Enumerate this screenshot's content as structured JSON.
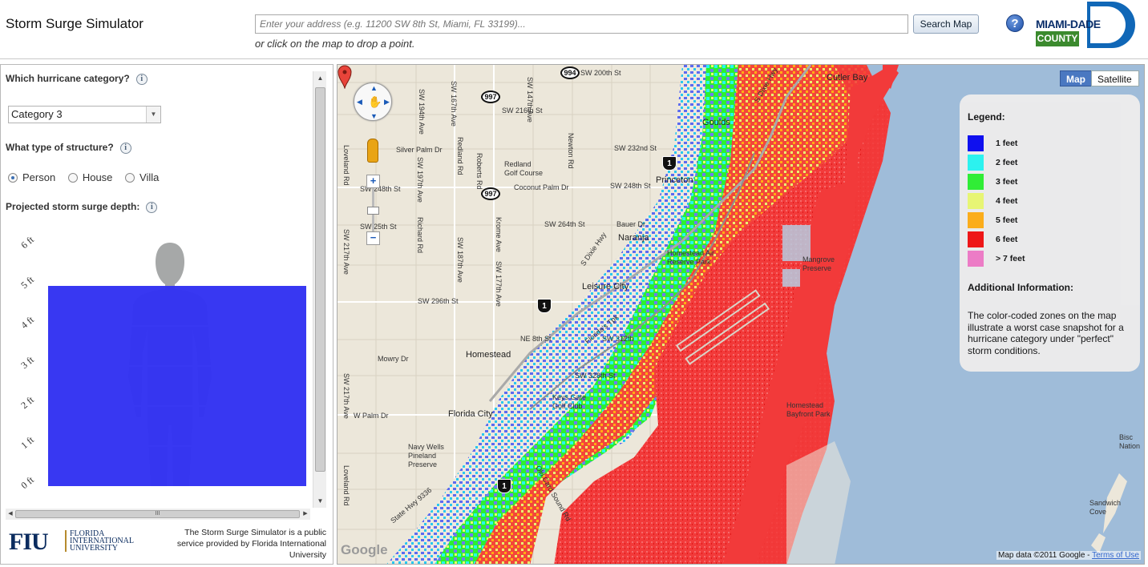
{
  "header": {
    "title": "Storm Surge Simulator",
    "search_placeholder": "Enter your address (e.g. 11200 SW 8th St, Miami, FL 33199)...",
    "search_button": "Search Map",
    "hint": "or click on the map to drop a point.",
    "help_icon": "?",
    "logo_line1": "MIAMI-DADE",
    "logo_line2": "COUNTY"
  },
  "panel": {
    "q_category": "Which hurricane category?",
    "category_selected": "Category 3",
    "q_structure": "What type of structure?",
    "structures": [
      {
        "label": "Person",
        "selected": true
      },
      {
        "label": "House",
        "selected": false
      },
      {
        "label": "Villa",
        "selected": false
      }
    ],
    "q_depth": "Projected storm surge depth:",
    "depth_ticks": [
      "0 ft",
      "1 ft",
      "2 ft",
      "3 ft",
      "4 ft",
      "5 ft",
      "6 ft"
    ],
    "surge_depth_ft": 5,
    "water_color": "#3434f2",
    "hscroll_grip": "III"
  },
  "footer": {
    "fiu": "FIU",
    "fiu_line1": "FLORIDA",
    "fiu_line2": "INTERNATIONAL",
    "fiu_line3": "UNIVERSITY",
    "credit": "The Storm Surge Simulator is a public service provided by Florida International University"
  },
  "map": {
    "type_map": "Map",
    "type_satellite": "Satellite",
    "legend_title": "Legend:",
    "legend": [
      {
        "label": "1 feet",
        "color": "#0a0af0"
      },
      {
        "label": "2 feet",
        "color": "#28f5f0"
      },
      {
        "label": "3 feet",
        "color": "#2cf030"
      },
      {
        "label": "4 feet",
        "color": "#eaf870"
      },
      {
        "label": "5 feet",
        "color": "#ffad14"
      },
      {
        "label": "6 feet",
        "color": "#f21010"
      },
      {
        "label": "> 7 feet",
        "color": "#f07ac6"
      }
    ],
    "additional_title": "Additional Information:",
    "additional_text": "The color-coded zones on the map illustrate a worst case snapshot for a hurricane category under \"perfect\" storm conditions.",
    "google": "Google",
    "attribution": "Map data ©2011 Google - ",
    "terms": "Terms of Use",
    "labels": {
      "homestead": "Homestead",
      "florida_city": "Florida City",
      "leisure_city": "Leisure City",
      "naranja": "Naranja",
      "princeton": "Princeton",
      "goulds": "Goulds",
      "cutler_bay": "Cutler Bay",
      "redland": "Redland\nGolf Course",
      "air_reserve": "Homestead Air\nReserve Park",
      "mangrove": "Mangrove\nPreserve",
      "bayfront": "Homestead\nBayfront Park",
      "navy_wells": "Navy Wells\nPineland\nPreserve",
      "keys_gate": "Keys Gate\nGolf Club",
      "sandwich": "Sandwich\nCove",
      "bisc": "Bisc\nNation",
      "sw200": "SW 200th St",
      "sw216": "SW 216th St",
      "sw232": "SW 232nd St",
      "sw248": "SW 248th St",
      "sw248b": "SW 248th St",
      "sw264": "SW 264th St",
      "sw296": "SW 296th St",
      "sw312": "SW 312th",
      "sw328": "SW 328th St",
      "silver": "Silver Palm Dr",
      "coconut": "Coconut Palm Dr",
      "bauer": "Bauer Dr",
      "mowry": "Mowry Dr",
      "wpalm": "W Palm Dr",
      "ne8": "NE 8th St",
      "sw197": "SW 197th Ave",
      "sw187": "SW 187th Ave",
      "sw177": "SW 177th Ave",
      "sw217": "SW 217th Ave",
      "sw217b": "SW 217th Ave",
      "sw194": "SW 194th Ave",
      "sw167": "SW 167th Ave",
      "sw147": "SW 147th Ave",
      "newton": "Newton Rd",
      "redland_rd": "Redland Rd",
      "roberts": "Roberts Rd",
      "krome": "Krome Ave",
      "richard": "Richard Rd",
      "loveland": "Loveland Rd",
      "loveland2": "Loveland Rd",
      "sdixie": "S Dixie Hwy",
      "sdixie2": "S Dixie Hwy",
      "card": "Old Card Sound Rd",
      "tollway": "Florida's Tpk",
      "sw25": "SW 25th St",
      "state9336": "State Hwy 9336"
    },
    "shields": [
      "994",
      "997",
      "997",
      "1",
      "1",
      "1"
    ]
  }
}
